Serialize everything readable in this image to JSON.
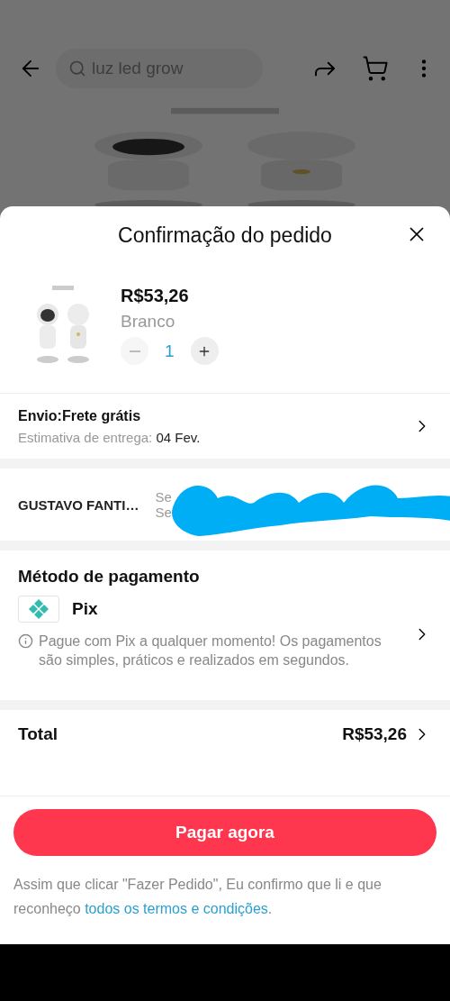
{
  "background_page": {
    "search": {
      "placeholder": "luz led grow"
    }
  },
  "sheet": {
    "title": "Confirmação do pedido",
    "product": {
      "price": "R$53,26",
      "variant": "Branco",
      "quantity": "1",
      "decrease_disabled": true
    },
    "shipping": {
      "title": "Envio:Frete grátis",
      "estimate_label": "Estimativa de entrega:",
      "estimate_value": "04 Fev."
    },
    "address": {
      "name": "GUSTAVO FANTI…",
      "lines": [
        "Se",
        "Se"
      ],
      "redacted": true
    },
    "payment": {
      "heading": "Método de pagamento",
      "method": "Pix",
      "note": "Pague com Pix a qualquer momento! Os pagamentos são simples, práticos e realizados em segundos."
    },
    "total": {
      "label": "Total",
      "value": "R$53,26"
    },
    "pay_button": "Pagar agora",
    "legal": {
      "text": "Assim que clicar \"Fazer Pedido\", Eu confirmo que li e que reconheço",
      "link": "todos os termos e condições",
      "end": "."
    }
  }
}
